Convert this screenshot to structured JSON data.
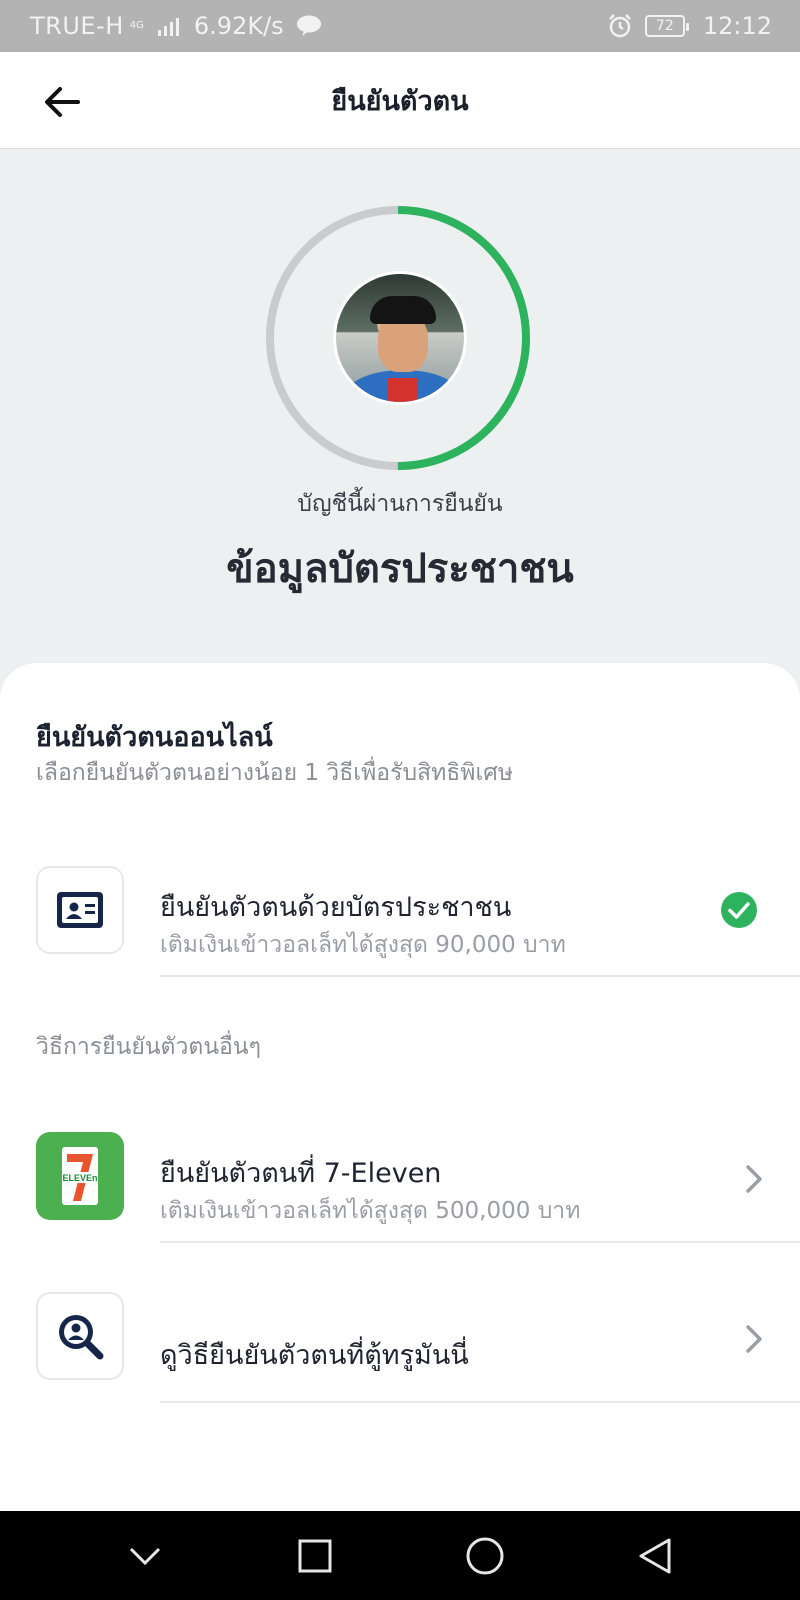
{
  "status_bar": {
    "carrier": "TRUE-H",
    "network_type": "4G",
    "speed": "6.92K/s",
    "battery": "72",
    "time": "12:12",
    "icons": [
      "signal-icon",
      "line-chat-icon",
      "alarm-icon",
      "battery-icon"
    ]
  },
  "header": {
    "title": "ยืนยันตัวตน",
    "back_icon": "arrow-left-icon"
  },
  "verification": {
    "progress": 0.5,
    "progress_color": "#2db35d",
    "track_color": "#c9cbcc",
    "status_label": "บัญชีนี้ผ่านการยืนยัน",
    "level_title": "ข้อมูลบัตรประชาชน"
  },
  "sheet": {
    "title": "ยืนยันตัวตนออนไลน์",
    "subtitle": "เลือกยืนยันตัวตนอย่างน้อย 1 วิธีเพื่อรับสิทธิพิเศษ",
    "primary_option": {
      "title": "ยืนยันตัวตนด้วยบัตรประชาชน",
      "subtitle": "เติมเงินเข้าวอลเล็ทได้สูงสุด 90,000 บาท",
      "icon": "id-card-icon",
      "completed": true
    },
    "other_methods_label": "วิธีการยืนยันตัวตนอื่นๆ",
    "other_options": [
      {
        "title": "ยืนยันตัวตนที่ 7-Eleven",
        "subtitle": "เติมเงินเข้าวอลเล็ทได้สูงสุด 500,000 บาท",
        "icon": "seven-eleven-logo",
        "logo_text": "ELEVEn"
      },
      {
        "title": "ดูวิธียืนยันตัวตนที่ตู้ทรูมันนี่",
        "icon": "user-search-icon"
      }
    ]
  },
  "colors": {
    "accent_green": "#2db35d",
    "navy_icon": "#16254a",
    "seven_green": "#4caf50"
  },
  "nav_bar": {
    "icons": [
      "chevron-down-icon",
      "recent-apps-icon",
      "home-icon",
      "back-triangle-icon"
    ]
  }
}
